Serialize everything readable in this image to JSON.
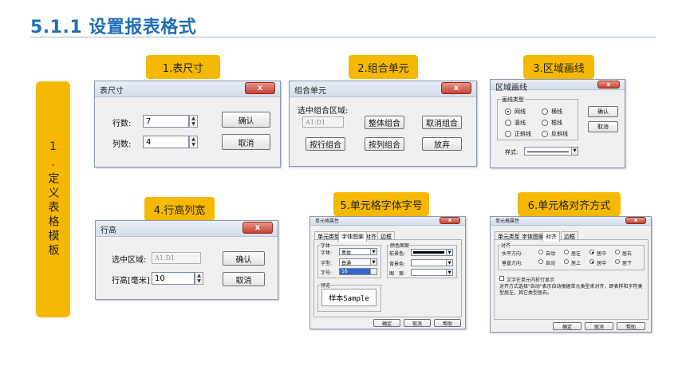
{
  "slide": {
    "title": "5.1.1 设置报表格式",
    "side_label": "1.定义表格模板"
  },
  "labels": {
    "l1": "1.表尺寸",
    "l2": "2.组合单元",
    "l3": "3.区域画线",
    "l4": "4.行高列宽",
    "l5": "5.单元格字体字号",
    "l6": "6.单元格对齐方式"
  },
  "d1": {
    "title": "表尺寸",
    "close": "x",
    "rows_label": "行数:",
    "rows_value": "7",
    "cols_label": "列数:",
    "cols_value": "4",
    "ok": "确认",
    "cancel": "取消"
  },
  "d2": {
    "title": "组合单元",
    "close": "x",
    "select_label": "选中组合区域:",
    "range_value": "A1:D1",
    "whole": "整体组合",
    "cancel_combine": "取消组合",
    "by_row": "按行组合",
    "by_col": "按列组合",
    "give_up": "放弃"
  },
  "d3": {
    "title": "区域画线",
    "close": "x",
    "group": "画线类型",
    "r1": "网线",
    "r2": "横线",
    "r3": "竖线",
    "r4": "框线",
    "r5": "正斜线",
    "r6": "反斜线",
    "style_label": "样式:",
    "ok": "确认",
    "cancel": "取消"
  },
  "d4": {
    "title": "行高",
    "close": "x",
    "select_label": "选中区域:",
    "range_value": "A1:D1",
    "height_label": "行高[毫米]",
    "height_value": "10",
    "ok": "确认",
    "cancel": "取消"
  },
  "d5": {
    "title": "单元格属性",
    "close": "x",
    "tabs": [
      "单元类型",
      "字体图案",
      "对齐",
      "边框"
    ],
    "font_group": "字体",
    "font_label": "字体:",
    "font_value": "黑体",
    "style_label": "字型:",
    "style_value": "普通",
    "size_label": "字号:",
    "size_value": "16",
    "color_group": "颜色图案",
    "fg_label": "前景色:",
    "bg_label": "背景色:",
    "pattern_label": "图　案:",
    "preview_group": "预览",
    "preview_text": "样本Sample",
    "ok": "确定",
    "cancel": "取消",
    "help": "帮助"
  },
  "d6": {
    "title": "单元格属性",
    "close": "x",
    "tabs": [
      "单元类型",
      "字体图案",
      "对齐",
      "边框"
    ],
    "align_group": "对齐",
    "h_label": "水平方向:",
    "v_label": "垂直方向:",
    "h_opts": [
      "自动",
      "居左",
      "居中",
      "居右"
    ],
    "v_opts": [
      "自动",
      "居上",
      "居中",
      "居下"
    ],
    "wrap_label": "文字在单元内折行显示",
    "note": "对齐方式选择\"自动\"表示自动根据单元类型来对齐，即表样和字符类型居左，其它类型居右。",
    "ok": "确定",
    "cancel": "取消",
    "help": "帮助"
  }
}
